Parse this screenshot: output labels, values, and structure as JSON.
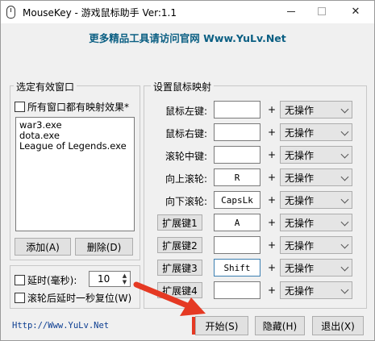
{
  "window": {
    "title": "MouseKey - 游戏鼠标助手 Ver:1.1",
    "icon": "mouse-icon"
  },
  "banner": "更多精品工具请访问官网  Www.YuLv.Net",
  "window_group": {
    "legend": "选定有效窗口",
    "all_windows_label": "所有窗口都有映射效果*",
    "items": [
      "war3.exe",
      "dota.exe",
      "League of Legends.exe"
    ],
    "add_label": "添加(A)",
    "delete_label": "删除(D)"
  },
  "delay_group": {
    "delay_label": "延时(毫秒):",
    "delay_value": "10",
    "reset_label": "滚轮后延时一秒复位(W)"
  },
  "mapping_group": {
    "legend": "设置鼠标映射",
    "plus": "+",
    "rows": [
      {
        "label": "鼠标左键:",
        "key": "",
        "action": "无操作"
      },
      {
        "label": "鼠标右键:",
        "key": "",
        "action": "无操作"
      },
      {
        "label": "滚轮中键:",
        "key": "",
        "action": "无操作"
      },
      {
        "label": "向上滚轮:",
        "key": "R",
        "action": "无操作"
      },
      {
        "label": "向下滚轮:",
        "key": "CapsLk",
        "action": "无操作"
      },
      {
        "label": "扩展键1",
        "key": "A",
        "action": "无操作"
      },
      {
        "label": "扩展键2",
        "key": "",
        "action": "无操作"
      },
      {
        "label": "扩展键3",
        "key": "Shift",
        "action": "无操作"
      },
      {
        "label": "扩展键4",
        "key": "",
        "action": "无操作"
      }
    ]
  },
  "footer": {
    "link": "Http://Www.YuLv.Net",
    "start_label": "开始(S)",
    "hide_label": "隐藏(H)",
    "exit_label": "退出(X)"
  },
  "colors": {
    "banner": "#0b5f83",
    "arrow": "#e53923",
    "link": "#0b3d91"
  }
}
